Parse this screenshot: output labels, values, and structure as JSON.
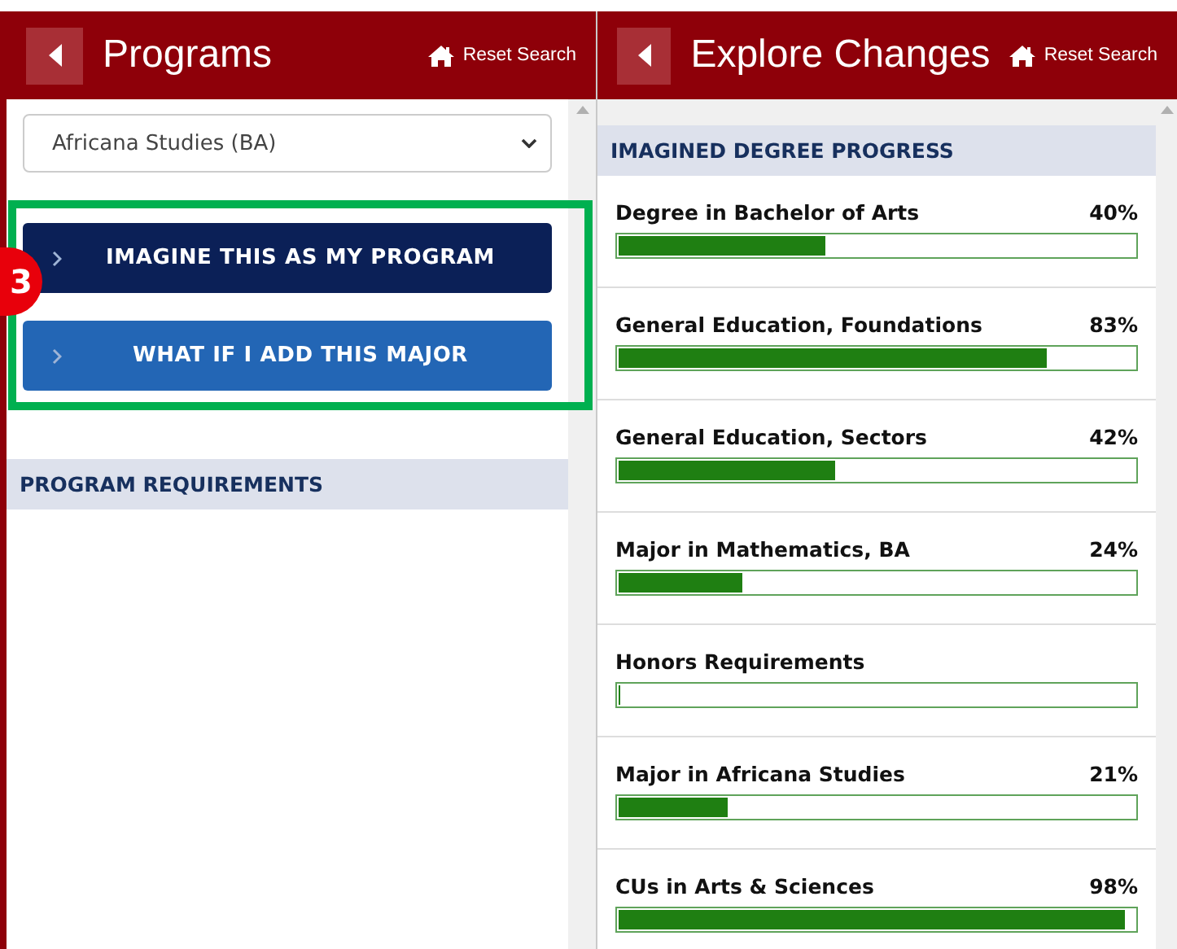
{
  "panels": [
    {
      "title": "Programs",
      "reset_label": "Reset Search"
    },
    {
      "title": "Explore Changes",
      "reset_label": "Reset Search"
    }
  ],
  "program_select": {
    "value": "Africana Studies (BA)"
  },
  "actions": [
    {
      "label": "IMAGINE THIS AS MY PROGRAM",
      "kind": "primary"
    },
    {
      "label": "WHAT IF I ADD THIS MAJOR",
      "kind": "secondary"
    }
  ],
  "callout": {
    "number": "3"
  },
  "program_requirements": {
    "heading": "PROGRAM REQUIREMENTS"
  },
  "progress": {
    "heading": "IMAGINED DEGREE PROGRESS",
    "items": [
      {
        "name": "Degree in Bachelor of Arts",
        "reading": "40%",
        "level": 0.4
      },
      {
        "name": "General Education, Foundations",
        "reading": "83%",
        "level": 0.83
      },
      {
        "name": "General Education, Sectors",
        "reading": "42%",
        "level": 0.42
      },
      {
        "name": "Major in Mathematics, BA",
        "reading": "24%",
        "level": 0.24
      },
      {
        "name": "Honors Requirements",
        "level": 0
      },
      {
        "name": "Major in Africana Studies",
        "reading": "21%",
        "level": 0.21
      },
      {
        "name": "CUs in Arts & Sciences",
        "reading": "98%",
        "level": 0.98
      }
    ]
  }
}
